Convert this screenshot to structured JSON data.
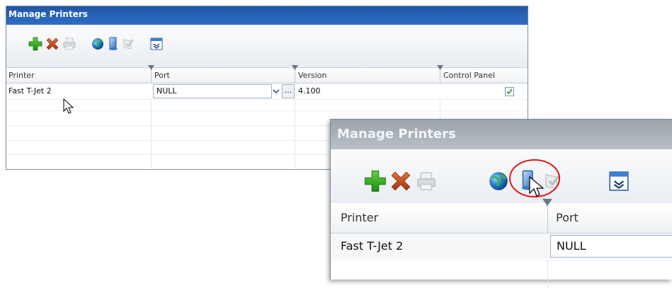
{
  "window_small": {
    "title": "Manage Printers",
    "toolbar": [
      "add-icon",
      "delete-icon",
      "printer-icon",
      "globe-icon",
      "computer-icon",
      "test-page-icon",
      "column-chooser-icon"
    ],
    "columns": [
      "Printer",
      "Port",
      "Version",
      "Control Panel"
    ],
    "rows": [
      {
        "printer": "Fast T-Jet 2",
        "port": "NULL",
        "version": "4.100",
        "control_panel": true
      }
    ],
    "browse_label": "..."
  },
  "window_zoom": {
    "title": "Manage Printers",
    "columns": [
      "Printer",
      "Port"
    ],
    "rows": [
      {
        "printer": "Fast T-Jet 2",
        "port": "NULL"
      }
    ]
  },
  "colors": {
    "title_active": "#2f6ec4",
    "title_inactive": "#a9b0b7",
    "highlight_circle": "#e01818",
    "add_green": "#2a9a20",
    "delete_orange": "#c4451c"
  }
}
